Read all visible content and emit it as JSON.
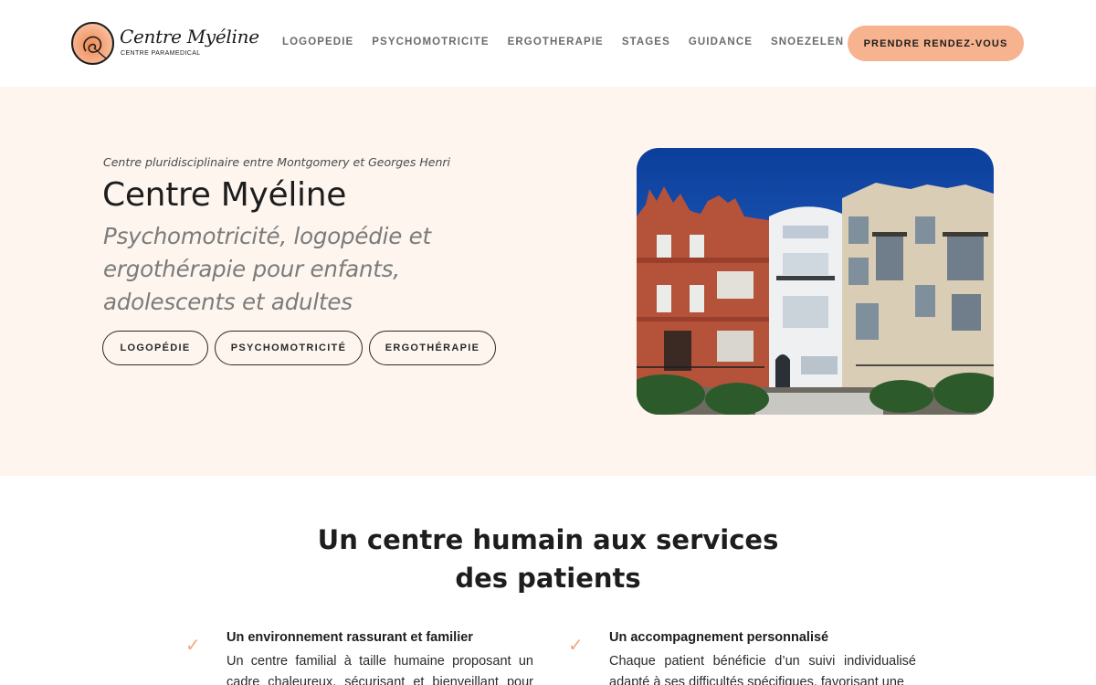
{
  "header": {
    "logo_name": "Centre Myéline",
    "logo_sub": "CENTRE PARAMEDICAL",
    "nav": [
      "LOGOPEDIE",
      "PSYCHOMOTRICITE",
      "ERGOTHERAPIE",
      "STAGES",
      "GUIDANCE",
      "SNOEZELEN"
    ],
    "cta_label": "PRENDRE RENDEZ-VOUS"
  },
  "hero": {
    "kicker": "Centre pluridisciplinaire entre Montgomery et Georges Henri",
    "title": "Centre Myéline",
    "subtitle": "Psychomotricité, logopédie et ergothérapie pour enfants, adolescents et adultes",
    "pills": [
      "LOGOPÉDIE",
      "PSYCHOMOTRICITÉ",
      "ERGOTHÉRAPIE"
    ]
  },
  "section": {
    "title_line1": "Un centre humain aux services",
    "title_line2": "des patients",
    "features": [
      {
        "title": "Un environnement rassurant et familier",
        "text": "Un centre familial à taille humaine proposant un cadre chaleureux, sécurisant et bienveillant pour que"
      },
      {
        "title": "Un accompagnement personnalisé",
        "text": "Chaque patient bénéficie d’un suivi individualisé adapté à ses difficultés spécifiques, favorisant une"
      }
    ]
  },
  "colors": {
    "accent": "#f7b38f",
    "hero_bg": "#fdf5ee",
    "check": "#f2a77e"
  }
}
